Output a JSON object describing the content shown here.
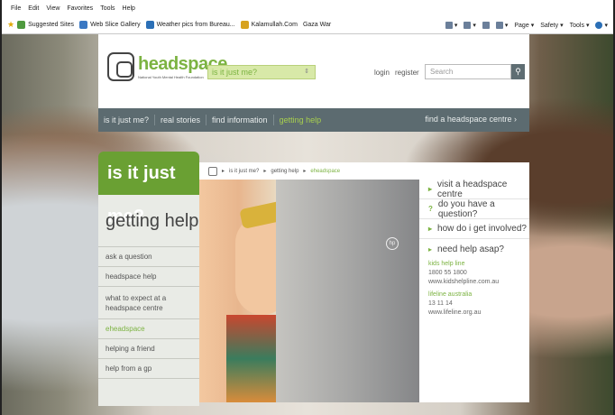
{
  "browser": {
    "menu": [
      "File",
      "Edit",
      "View",
      "Favorites",
      "Tools",
      "Help"
    ],
    "favorites": [
      {
        "label": "Suggested Sites",
        "color": "#4f9a3e"
      },
      {
        "label": "Web Slice Gallery",
        "color": "#3a78c3"
      },
      {
        "label": "Weather pics from Bureau...",
        "color": "#2b6fb6"
      },
      {
        "label": "Kalamullah.Com",
        "color": "#d7a21f"
      },
      {
        "label": "Gaza War",
        "color": "#ffffff"
      }
    ],
    "tools": [
      "Page",
      "Safety",
      "Tools"
    ]
  },
  "header": {
    "logo_name": "headspace",
    "logo_sub": "National Youth Mental Health Foundation",
    "dropdown_value": "is it just me?",
    "login": "login",
    "register": "register",
    "search_placeholder": "Search"
  },
  "nav": {
    "items": [
      "is it just me?",
      "real stories",
      "find information",
      "getting help"
    ],
    "find_centre": "find a headspace centre"
  },
  "sidebar": {
    "title": "is it just me?",
    "heading": "getting help",
    "items": [
      {
        "label": "ask a question",
        "active": false
      },
      {
        "label": "headspace help",
        "active": false
      },
      {
        "label": "what to expect at a headspace centre",
        "active": false
      },
      {
        "label": "eheadspace",
        "active": true
      },
      {
        "label": "helping a friend",
        "active": false
      },
      {
        "label": "help from a gp",
        "active": false
      }
    ]
  },
  "breadcrumb": [
    "is it just me?",
    "getting help",
    "eheadspace"
  ],
  "right_panel": {
    "links": [
      {
        "marker": "▸",
        "label": "visit a headspace centre"
      },
      {
        "marker": "?",
        "label": "do you have a question?"
      },
      {
        "marker": "▸",
        "label": "how do i get involved?"
      }
    ],
    "help_title": "need help asap?",
    "kids_label": "kids help line",
    "kids_phone": "1800 55 1800",
    "kids_url": "www.kidshelpline.com.au",
    "lifeline_label": "lifeline australia",
    "lifeline_phone": "13 11 14",
    "lifeline_url": "www.lifeline.org.au"
  },
  "colors": {
    "brand_green": "#7cb342",
    "nav_bg": "#5c6b70"
  }
}
